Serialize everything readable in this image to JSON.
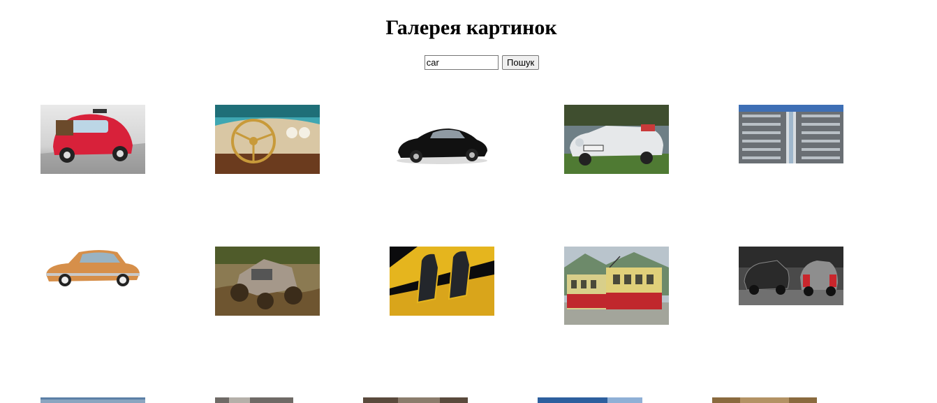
{
  "header": {
    "title": "Галерея картинок"
  },
  "search": {
    "value": "car",
    "button_label": "Пошук"
  },
  "gallery": {
    "rows": [
      [
        {
          "name": "red-vintage-car-image",
          "description": "red Fiat 500 with luggage"
        },
        {
          "name": "car-interior-dashboard-image",
          "description": "classic car dashboard and steering wheel"
        },
        {
          "name": "black-sports-car-image",
          "description": "black Mercedes gullwing"
        },
        {
          "name": "white-convertible-car-image",
          "description": "white vintage convertible on grass"
        },
        {
          "name": "car-parking-tower-image",
          "description": "glass car tower"
        }
      ],
      [
        {
          "name": "orange-vintage-car-image",
          "description": "orange Mercedes coupe"
        },
        {
          "name": "offroad-jeep-mud-image",
          "description": "jeep in mud"
        },
        {
          "name": "sports-car-seats-image",
          "description": "black and yellow sports car seats"
        },
        {
          "name": "red-yellow-train-image",
          "description": "mountain railway train"
        },
        {
          "name": "old-cars-bw-image",
          "description": "old cars black and white with red"
        }
      ],
      [
        {
          "name": "gallery-image-11"
        },
        {
          "name": "gallery-image-12"
        },
        {
          "name": "gallery-image-13"
        },
        {
          "name": "gallery-image-14"
        },
        {
          "name": "gallery-image-15"
        }
      ]
    ]
  }
}
